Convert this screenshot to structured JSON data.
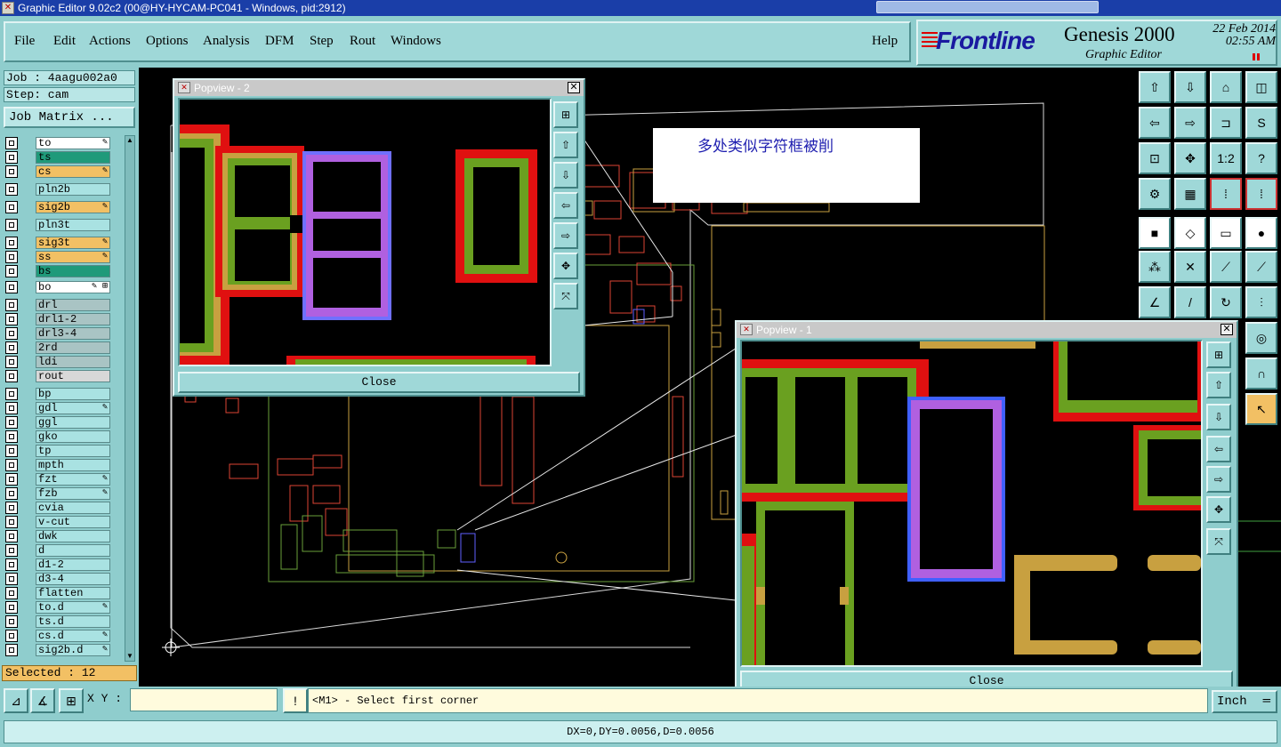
{
  "window": {
    "title": "Graphic Editor 9.02c2 (00@HY-HYCAM-PC041 - Windows, pid:2912)"
  },
  "menu": {
    "items": [
      "File",
      "Edit",
      "Actions",
      "Options",
      "Analysis",
      "DFM",
      "Step",
      "Rout",
      "Windows"
    ],
    "help": "Help"
  },
  "logo": {
    "brand": "Frontline",
    "product": "Genesis 2000",
    "subtitle": "Graphic Editor",
    "date": "22 Feb 2014",
    "time": "02:55 AM"
  },
  "left": {
    "job": "Job : 4aagu002a0",
    "step": "Step: cam",
    "job_matrix": "Job Matrix ...",
    "selected": "Selected : 12"
  },
  "layers": [
    {
      "name": "to",
      "color": "#ffffff",
      "mark": "✎"
    },
    {
      "name": "ts",
      "color": "#1f9a7a",
      "mark": ""
    },
    {
      "name": "cs",
      "color": "#f2c064",
      "mark": "✎"
    },
    {
      "name": "pln2b",
      "color": "#a9e2e2",
      "mark": ""
    },
    {
      "name": "sig2b",
      "color": "#f2c064",
      "mark": "✎"
    },
    {
      "name": "pln3t",
      "color": "#a9e2e2",
      "mark": ""
    },
    {
      "name": "sig3t",
      "color": "#f2c064",
      "mark": "✎"
    },
    {
      "name": "ss",
      "color": "#f2c064",
      "mark": "✎"
    },
    {
      "name": "bs",
      "color": "#1f9a7a",
      "mark": ""
    },
    {
      "name": "bo",
      "color": "#ffffff",
      "mark": "✎ ⊞"
    },
    {
      "name": "drl",
      "color": "#a9c4c4",
      "mark": ""
    },
    {
      "name": "drl1-2",
      "color": "#a9c4c4",
      "mark": ""
    },
    {
      "name": "drl3-4",
      "color": "#a9c4c4",
      "mark": ""
    },
    {
      "name": "2rd",
      "color": "#a9c4c4",
      "mark": ""
    },
    {
      "name": "ldi",
      "color": "#a9c4c4",
      "mark": ""
    },
    {
      "name": "rout",
      "color": "#d8d8d8",
      "mark": ""
    },
    {
      "name": "bp",
      "color": "#a9e2e2",
      "mark": ""
    },
    {
      "name": "gdl",
      "color": "#a9e2e2",
      "mark": "✎"
    },
    {
      "name": "ggl",
      "color": "#a9e2e2",
      "mark": ""
    },
    {
      "name": "gko",
      "color": "#a9e2e2",
      "mark": ""
    },
    {
      "name": "tp",
      "color": "#a9e2e2",
      "mark": ""
    },
    {
      "name": "mpth",
      "color": "#a9e2e2",
      "mark": ""
    },
    {
      "name": "fzt",
      "color": "#a9e2e2",
      "mark": "✎"
    },
    {
      "name": "fzb",
      "color": "#a9e2e2",
      "mark": "✎"
    },
    {
      "name": "cvia",
      "color": "#a9e2e2",
      "mark": ""
    },
    {
      "name": "v-cut",
      "color": "#a9e2e2",
      "mark": ""
    },
    {
      "name": "dwk",
      "color": "#a9e2e2",
      "mark": ""
    },
    {
      "name": "d",
      "color": "#a9e2e2",
      "mark": ""
    },
    {
      "name": "d1-2",
      "color": "#a9e2e2",
      "mark": ""
    },
    {
      "name": "d3-4",
      "color": "#a9e2e2",
      "mark": ""
    },
    {
      "name": "flatten",
      "color": "#a9e2e2",
      "mark": ""
    },
    {
      "name": "to.d",
      "color": "#a9e2e2",
      "mark": "✎"
    },
    {
      "name": "ts.d",
      "color": "#a9e2e2",
      "mark": ""
    },
    {
      "name": "cs.d",
      "color": "#a9e2e2",
      "mark": "✎"
    },
    {
      "name": "sig2b.d",
      "color": "#a9e2e2",
      "mark": "✎"
    }
  ],
  "note": "多处类似字符框被削",
  "popup2": {
    "title": "Popview - 2",
    "close": "Close"
  },
  "popup1": {
    "title": "Popview - 1",
    "close": "Close"
  },
  "bottom": {
    "xy_label": "X Y :",
    "xy_value": "",
    "prompt": "<M1> - Select first corner",
    "units": "Inch"
  },
  "status": "DX=0,DY=0.0056,D=0.0056"
}
